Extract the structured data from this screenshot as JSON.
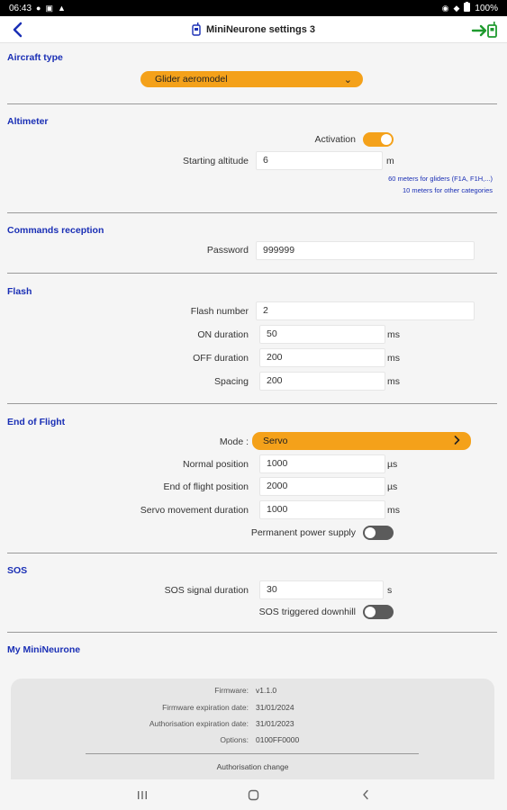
{
  "status_bar": {
    "time": "06:43",
    "battery": "100%"
  },
  "header": {
    "title": "MiniNeurone settings 3"
  },
  "aircraft_type": {
    "title": "Aircraft type",
    "selected": "Glider aeromodel"
  },
  "altimeter": {
    "title": "Altimeter",
    "activation_label": "Activation",
    "activation_on": true,
    "starting_altitude_label": "Starting altitude",
    "starting_altitude_value": "6",
    "starting_altitude_unit": "m",
    "hint_line1": "60 meters for gliders (F1A, F1H,...)",
    "hint_line2": "10 meters for other categories"
  },
  "commands_reception": {
    "title": "Commands reception",
    "password_label": "Password",
    "password_value": "999999"
  },
  "flash": {
    "title": "Flash",
    "number_label": "Flash number",
    "number_value": "2",
    "on_label": "ON duration",
    "on_value": "50",
    "on_unit": "ms",
    "off_label": "OFF duration",
    "off_value": "200",
    "off_unit": "ms",
    "spacing_label": "Spacing",
    "spacing_value": "200",
    "spacing_unit": "ms"
  },
  "end_of_flight": {
    "title": "End of Flight",
    "mode_label": "Mode :",
    "mode_value": "Servo",
    "normal_label": "Normal position",
    "normal_value": "1000",
    "normal_unit": "µs",
    "eof_label": "End of flight position",
    "eof_value": "2000",
    "eof_unit": "µs",
    "servo_label": "Servo movement duration",
    "servo_value": "1000",
    "servo_unit": "ms",
    "permanent_label": "Permanent power supply",
    "permanent_on": false
  },
  "sos": {
    "title": "SOS",
    "duration_label": "SOS signal duration",
    "duration_value": "30",
    "duration_unit": "s",
    "downhill_label": "SOS triggered downhill",
    "downhill_on": false
  },
  "my_mineurone": {
    "title": "My MiniNeurone",
    "firmware_label": "Firmware:",
    "firmware_value": "v1.1.0",
    "fw_exp_label": "Firmware expiration date:",
    "fw_exp_value": "31/01/2024",
    "auth_exp_label": "Authorisation expiration date:",
    "auth_exp_value": "31/01/2023",
    "options_label": "Options:",
    "options_value": "0100FF0000",
    "auth_change": "Authorisation change"
  },
  "colors": {
    "accent": "#f4a11a",
    "section_title": "#1a2fb5",
    "back_arrow": "#1a2fb5",
    "exit_icon": "#1e9a2e"
  }
}
